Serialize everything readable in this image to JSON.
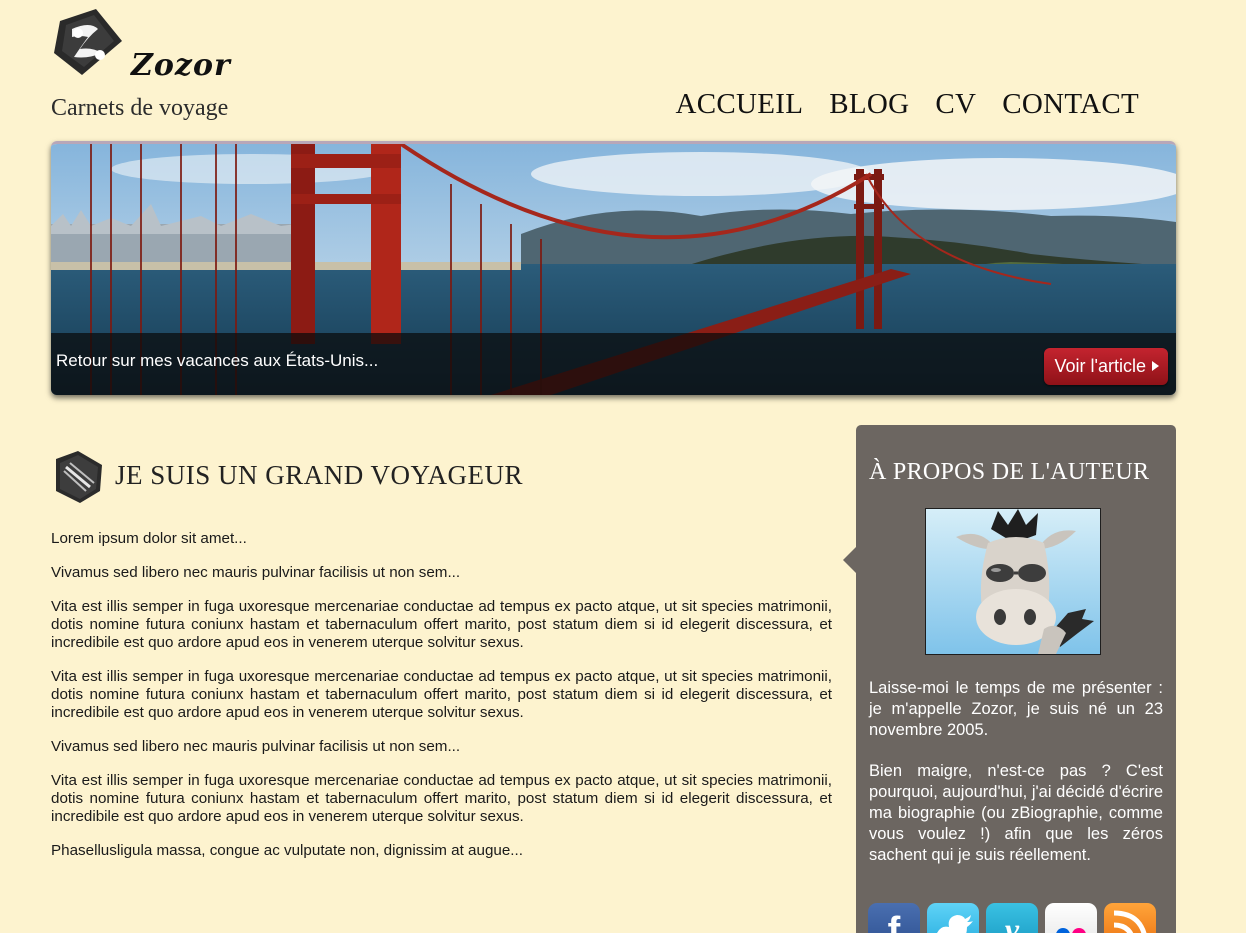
{
  "header": {
    "logo_text": "Zozor",
    "tagline": "Carnets de voyage",
    "nav": [
      {
        "label": "ACCUEIL"
      },
      {
        "label": "BLOG"
      },
      {
        "label": "CV"
      },
      {
        "label": "CONTACT"
      }
    ]
  },
  "banner": {
    "caption": "Retour sur mes vacances aux États-Unis...",
    "button_label": "Voir l'article"
  },
  "article": {
    "title": "JE SUIS UN GRAND VOYAGEUR",
    "paragraphs": [
      "Lorem ipsum dolor sit amet...",
      "Vivamus sed libero nec mauris pulvinar facilisis ut non sem...",
      "Vita est illis semper in fuga uxoresque mercenariae conductae ad tempus ex pacto atque, ut sit species matrimonii, dotis nomine futura coniunx hastam et tabernaculum offert marito, post statum diem si id elegerit discessura, et incredibile est quo ardore apud eos in venerem uterque solvitur sexus.",
      "Vita est illis semper in fuga uxoresque mercenariae conductae ad tempus ex pacto atque, ut sit species matrimonii, dotis nomine futura coniunx hastam et tabernaculum offert marito, post statum diem si id elegerit discessura, et incredibile est quo ardore apud eos in venerem uterque solvitur sexus.",
      "Vivamus sed libero nec mauris pulvinar facilisis ut non sem...",
      "Vita est illis semper in fuga uxoresque mercenariae conductae ad tempus ex pacto atque, ut sit species matrimonii, dotis nomine futura coniunx hastam et tabernaculum offert marito, post statum diem si id elegerit discessura, et incredibile est quo ardore apud eos in venerem uterque solvitur sexus.",
      "Phasellusligula massa, congue ac vulputate non, dignissim at augue..."
    ]
  },
  "sidebar": {
    "title": "À PROPOS DE L'AUTEUR",
    "paragraphs": [
      "Laisse-moi le temps de me présenter : je m'appelle Zozor, je suis né un 23 novembre 2005.",
      "Bien maigre, n'est-ce pas ? C'est pourquoi, aujourd'hui, j'ai décidé d'écrire ma biographie (ou zBiographie, comme vous voulez !) afin que les zéros sachent qui je suis réellement."
    ],
    "social": [
      {
        "icon": "facebook-icon",
        "glyph": "f"
      },
      {
        "icon": "twitter-icon"
      },
      {
        "icon": "vimeo-icon",
        "glyph": "v"
      },
      {
        "icon": "flickr-icon"
      },
      {
        "icon": "rss-icon"
      }
    ]
  },
  "colors": {
    "background": "#fdf3cf",
    "sidebar": "#6c6661",
    "button": "#b01c25"
  }
}
